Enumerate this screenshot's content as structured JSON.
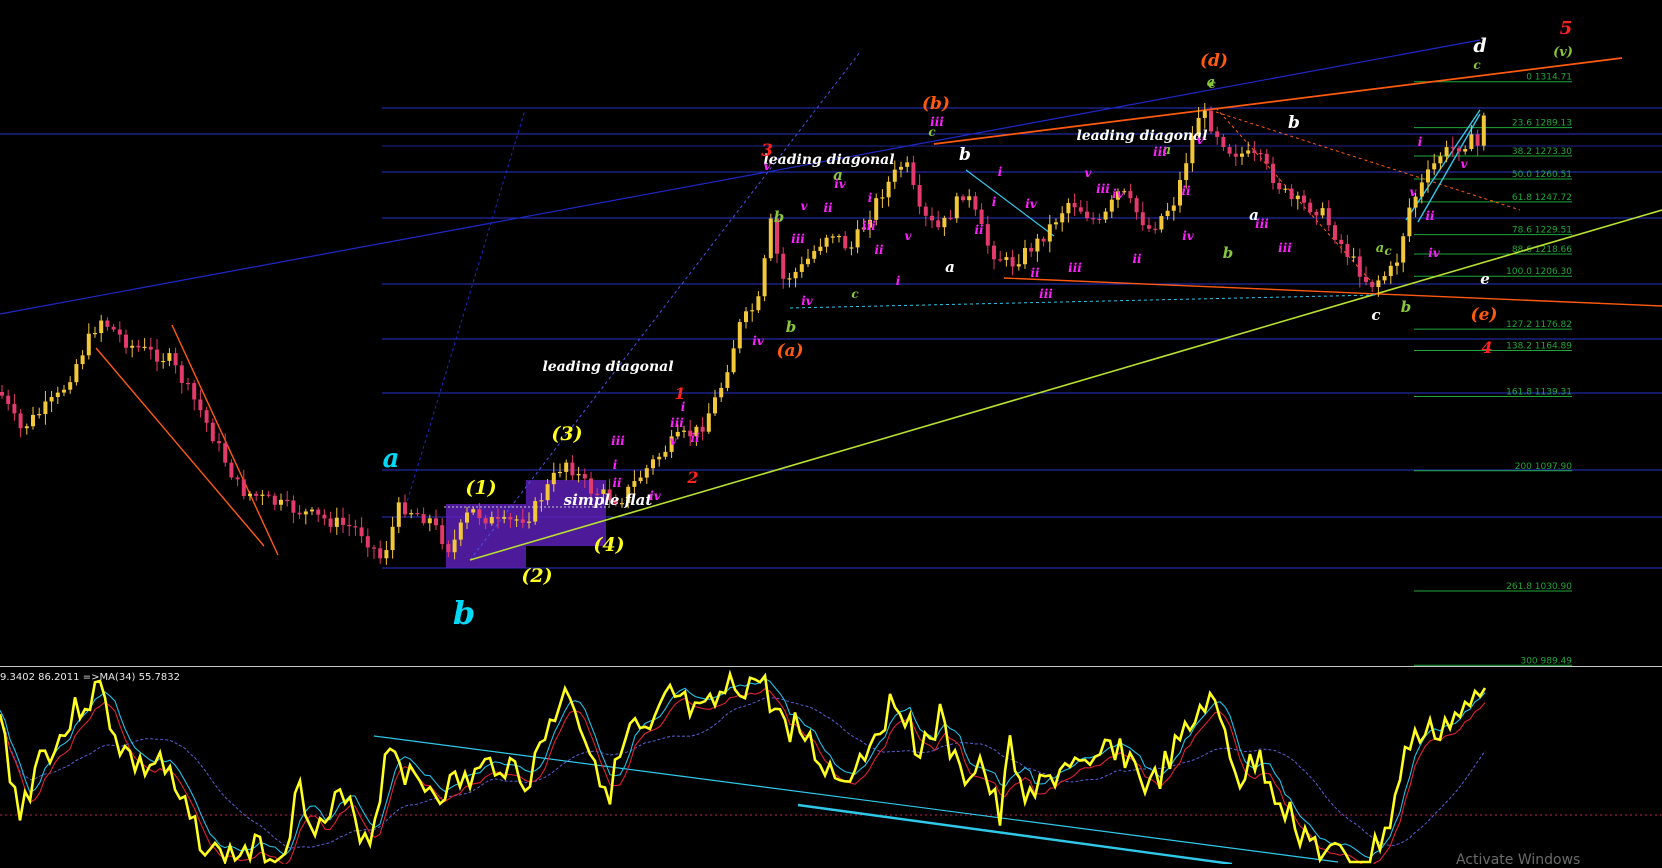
{
  "colors": {
    "background": "#000000",
    "bull": "#f2c73a",
    "bear": "#e23a6a",
    "hline": "#2a35c8",
    "fib": "#1fa63a",
    "oscillator_main": "#ffff20",
    "oscillator_signal_red": "#e02030",
    "oscillator_signal_cyan": "#20c0e8",
    "ma": "#5a60d8",
    "trend_yellowgreen": "#b8e030",
    "trend_orange": "#ff5a10",
    "channel_cyan": "#30c8e8"
  },
  "indicator": {
    "header": "9.3402 86.2011  =>MA(34) 55.7832"
  },
  "fib_levels": [
    {
      "label": "0 1314.71",
      "price": 1314.71
    },
    {
      "label": "23.6 1289.13",
      "price": 1289.13
    },
    {
      "label": "38.2 1273.30",
      "price": 1273.3
    },
    {
      "label": "50.0 1260.51",
      "price": 1260.51
    },
    {
      "label": "61.8 1247.72",
      "price": 1247.72
    },
    {
      "label": "78.6 1229.51",
      "price": 1229.51
    },
    {
      "label": "88.6 1218.66",
      "price": 1218.66
    },
    {
      "label": "100.0 1206.30",
      "price": 1206.3
    },
    {
      "label": "127.2 1176.82",
      "price": 1176.82
    },
    {
      "label": "138.2 1164.89",
      "price": 1164.89
    },
    {
      "label": "161.8 1139.31",
      "price": 1139.31
    },
    {
      "label": "200 1097.90",
      "price": 1097.9
    },
    {
      "label": "261.8 1030.90",
      "price": 1030.9
    },
    {
      "label": "300 989.49",
      "price": 989.49
    }
  ],
  "annotations": [
    {
      "text": "a",
      "color": "#00d8f8",
      "size": 26
    },
    {
      "text": "b",
      "color": "#00d8f8",
      "size": 32
    },
    {
      "text": "(1)",
      "color": "#ffff20",
      "size": 19
    },
    {
      "text": "(2)",
      "color": "#ffff20",
      "size": 19
    },
    {
      "text": "(3)",
      "color": "#ffff20",
      "size": 19
    },
    {
      "text": "(4)",
      "color": "#ffff20",
      "size": 19
    },
    {
      "text": "leading diagonal",
      "color": "#ffffff",
      "size": 14
    },
    {
      "text": "leading diagonal",
      "color": "#ffffff",
      "size": 14
    },
    {
      "text": "leading diagonal",
      "color": "#ffffff",
      "size": 14
    },
    {
      "text": "simple flat",
      "color": "#ffffff",
      "size": 15
    },
    {
      "text": "3",
      "color": "#ff2020",
      "size": 17
    },
    {
      "text": "1",
      "color": "#ff2020",
      "size": 16
    },
    {
      "text": "2",
      "color": "#ff2020",
      "size": 16
    },
    {
      "text": "4",
      "color": "#ff2020",
      "size": 16
    },
    {
      "text": "5",
      "color": "#ff2020",
      "size": 18
    },
    {
      "text": "(a)",
      "color": "#ff5a10",
      "size": 17
    },
    {
      "text": "(b)",
      "color": "#ff5a10",
      "size": 17
    },
    {
      "text": "(d)",
      "color": "#ff5a10",
      "size": 17
    },
    {
      "text": "(e)",
      "color": "#ff5a10",
      "size": 17
    },
    {
      "text": "(v)",
      "color": "#88c83a",
      "size": 13
    },
    {
      "text": "d",
      "color": "#ffffff",
      "size": 19
    },
    {
      "text": "b",
      "color": "#ffffff",
      "size": 17
    },
    {
      "text": "b",
      "color": "#ffffff",
      "size": 17
    },
    {
      "text": "a",
      "color": "#ffffff",
      "size": 15
    },
    {
      "text": "a",
      "color": "#ffffff",
      "size": 15
    },
    {
      "text": "c",
      "color": "#ffffff",
      "size": 15
    },
    {
      "text": "e",
      "color": "#ffffff",
      "size": 15
    },
    {
      "text": "a",
      "color": "#88c83a",
      "size": 15
    },
    {
      "text": "b",
      "color": "#88c83a",
      "size": 15
    },
    {
      "text": "c",
      "color": "#88c83a",
      "size": 12
    },
    {
      "text": "a",
      "color": "#88c83a",
      "size": 13
    },
    {
      "text": "b",
      "color": "#88c83a",
      "size": 15
    },
    {
      "text": "c",
      "color": "#88c83a",
      "size": 12
    },
    {
      "text": "a",
      "color": "#88c83a",
      "size": 13
    },
    {
      "text": "b",
      "color": "#88c83a",
      "size": 15
    },
    {
      "text": "c",
      "color": "#88c83a",
      "size": 12
    },
    {
      "text": "a",
      "color": "#88c83a",
      "size": 13
    },
    {
      "text": "b",
      "color": "#88c83a",
      "size": 15
    },
    {
      "text": "c",
      "color": "#88c83a",
      "size": 12
    },
    {
      "text": "c",
      "color": "#88c83a",
      "size": 12
    },
    {
      "text": "i",
      "color": "#ff20ff",
      "size": 12
    },
    {
      "text": "ii",
      "color": "#ff20ff",
      "size": 12
    },
    {
      "text": "iii",
      "color": "#ff20ff",
      "size": 12
    },
    {
      "text": "iv",
      "color": "#ff20ff",
      "size": 12
    },
    {
      "text": "v",
      "color": "#ff20ff",
      "size": 12
    },
    {
      "text": "iii",
      "color": "#ff20ff",
      "size": 12
    },
    {
      "text": "i",
      "color": "#ff20ff",
      "size": 12
    },
    {
      "text": "ii",
      "color": "#ff20ff",
      "size": 12
    },
    {
      "text": "iv",
      "color": "#ff20ff",
      "size": 12
    },
    {
      "text": "v",
      "color": "#ff20ff",
      "size": 12
    },
    {
      "text": "i",
      "color": "#ff20ff",
      "size": 12
    },
    {
      "text": "ii",
      "color": "#ff20ff",
      "size": 12
    },
    {
      "text": "iii",
      "color": "#ff20ff",
      "size": 12
    },
    {
      "text": "iv",
      "color": "#ff20ff",
      "size": 12
    },
    {
      "text": "i",
      "color": "#ff20ff",
      "size": 12
    },
    {
      "text": "ii",
      "color": "#ff20ff",
      "size": 12
    },
    {
      "text": "iii",
      "color": "#ff20ff",
      "size": 12
    },
    {
      "text": "iv",
      "color": "#ff20ff",
      "size": 12
    },
    {
      "text": "v",
      "color": "#ff20ff",
      "size": 12
    },
    {
      "text": "iii",
      "color": "#ff20ff",
      "size": 12
    },
    {
      "text": "v",
      "color": "#ff20ff",
      "size": 12
    },
    {
      "text": "i",
      "color": "#ff20ff",
      "size": 12
    },
    {
      "text": "ii",
      "color": "#ff20ff",
      "size": 12
    },
    {
      "text": "i",
      "color": "#ff20ff",
      "size": 12
    },
    {
      "text": "iii",
      "color": "#ff20ff",
      "size": 12
    },
    {
      "text": "iv",
      "color": "#ff20ff",
      "size": 12
    },
    {
      "text": "ii",
      "color": "#ff20ff",
      "size": 12
    },
    {
      "text": "iii",
      "color": "#ff20ff",
      "size": 12
    },
    {
      "text": "v",
      "color": "#ff20ff",
      "size": 12
    },
    {
      "text": "iv",
      "color": "#ff20ff",
      "size": 12
    },
    {
      "text": "ii",
      "color": "#ff20ff",
      "size": 12
    },
    {
      "text": "iii",
      "color": "#ff20ff",
      "size": 12
    },
    {
      "text": "iii",
      "color": "#ff20ff",
      "size": 12
    },
    {
      "text": "ii",
      "color": "#ff20ff",
      "size": 12
    },
    {
      "text": "iv",
      "color": "#ff20ff",
      "size": 12
    },
    {
      "text": "v",
      "color": "#ff20ff",
      "size": 12
    },
    {
      "text": "iii",
      "color": "#ff20ff",
      "size": 12
    },
    {
      "text": "iii",
      "color": "#ff20ff",
      "size": 12
    },
    {
      "text": "ii",
      "color": "#ff20ff",
      "size": 12
    },
    {
      "text": "i",
      "color": "#ff20ff",
      "size": 12
    },
    {
      "text": "iv",
      "color": "#ff20ff",
      "size": 12
    },
    {
      "text": "v",
      "color": "#ff20ff",
      "size": 12
    },
    {
      "text": "v",
      "color": "#ff20ff",
      "size": 12
    }
  ],
  "chart_data": {
    "type": "candlestick",
    "series": [
      {
        "name": "price"
      },
      {
        "name": "oscillator"
      }
    ]
  },
  "watermark": "Activate Windows"
}
